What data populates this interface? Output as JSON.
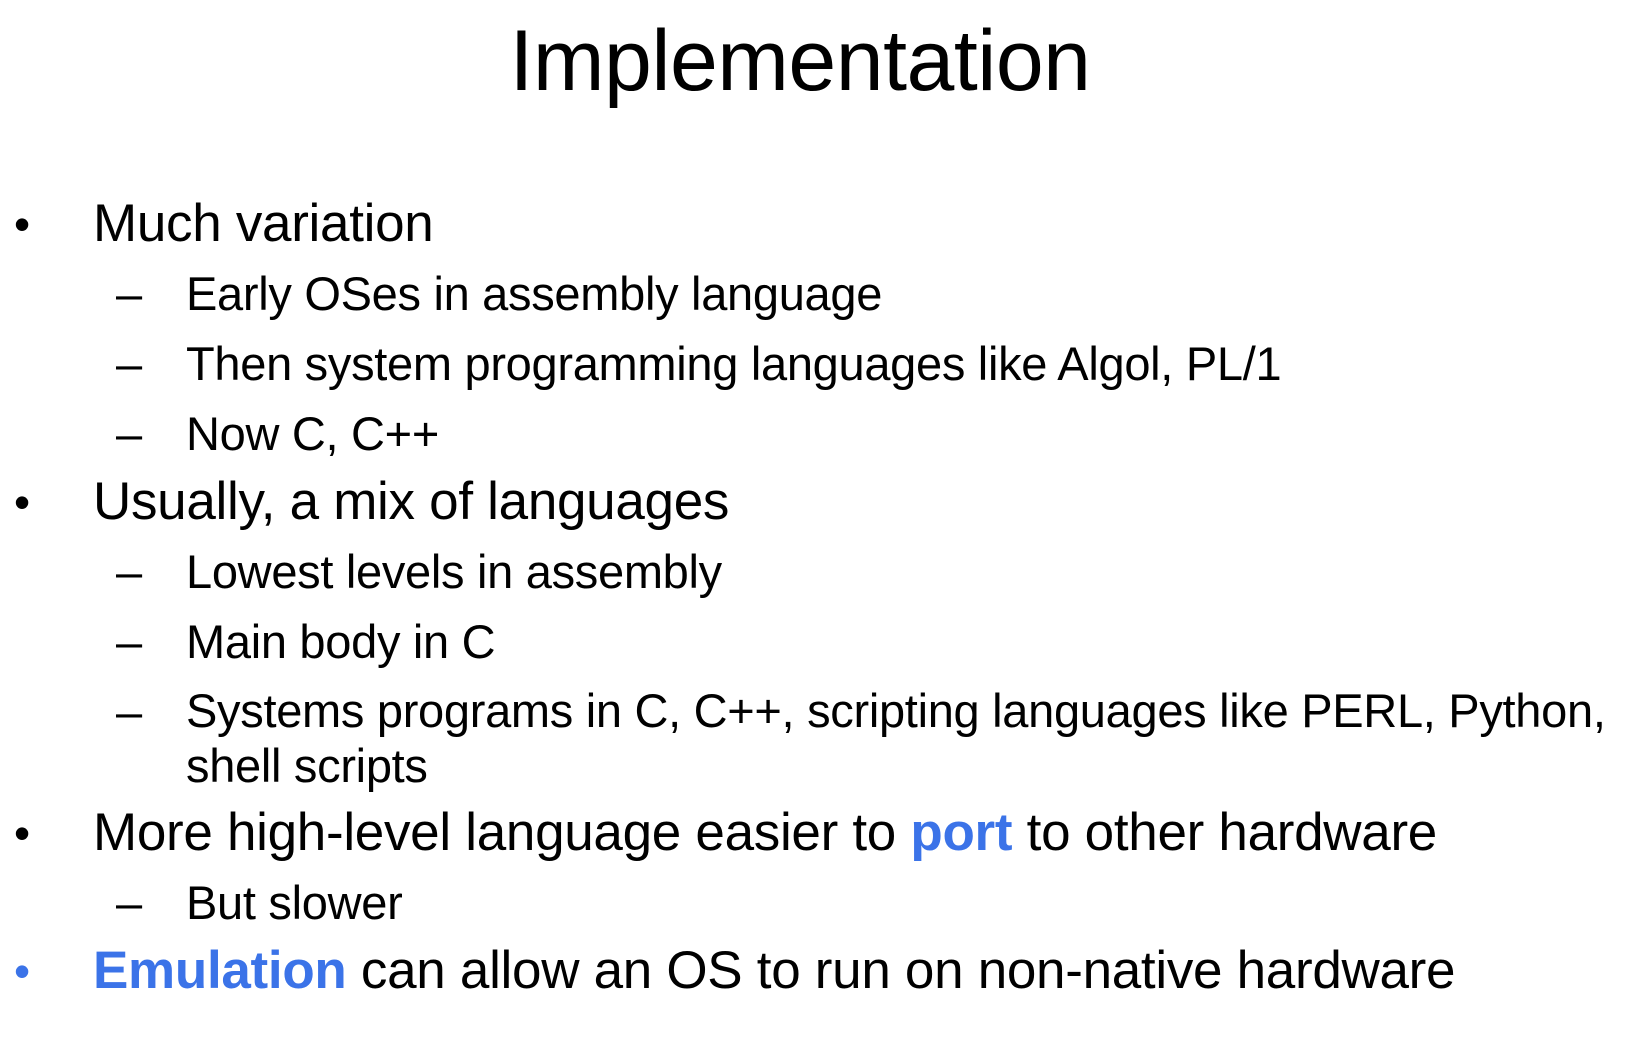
{
  "slide": {
    "title": "Implementation",
    "bullet_marker": "•",
    "sub_marker": "–",
    "accent_color": "#3b73e8",
    "bullets": [
      {
        "text": "Much variation",
        "children": [
          "Early OSes in assembly language",
          "Then system programming languages like Algol, PL/1",
          "Now C, C++"
        ]
      },
      {
        "text": "Usually, a mix of languages",
        "children": [
          "Lowest levels in assembly",
          "Main body in C",
          "Systems programs in C, C++, scripting languages like PERL, Python, shell scripts"
        ]
      },
      {
        "text_before": "More high-level language easier to ",
        "highlight": "port",
        "text_after": " to other hardware",
        "children": [
          "But slower"
        ]
      },
      {
        "highlight": "Emulation",
        "text_after": " can allow an OS to run on non-native hardware"
      }
    ]
  }
}
